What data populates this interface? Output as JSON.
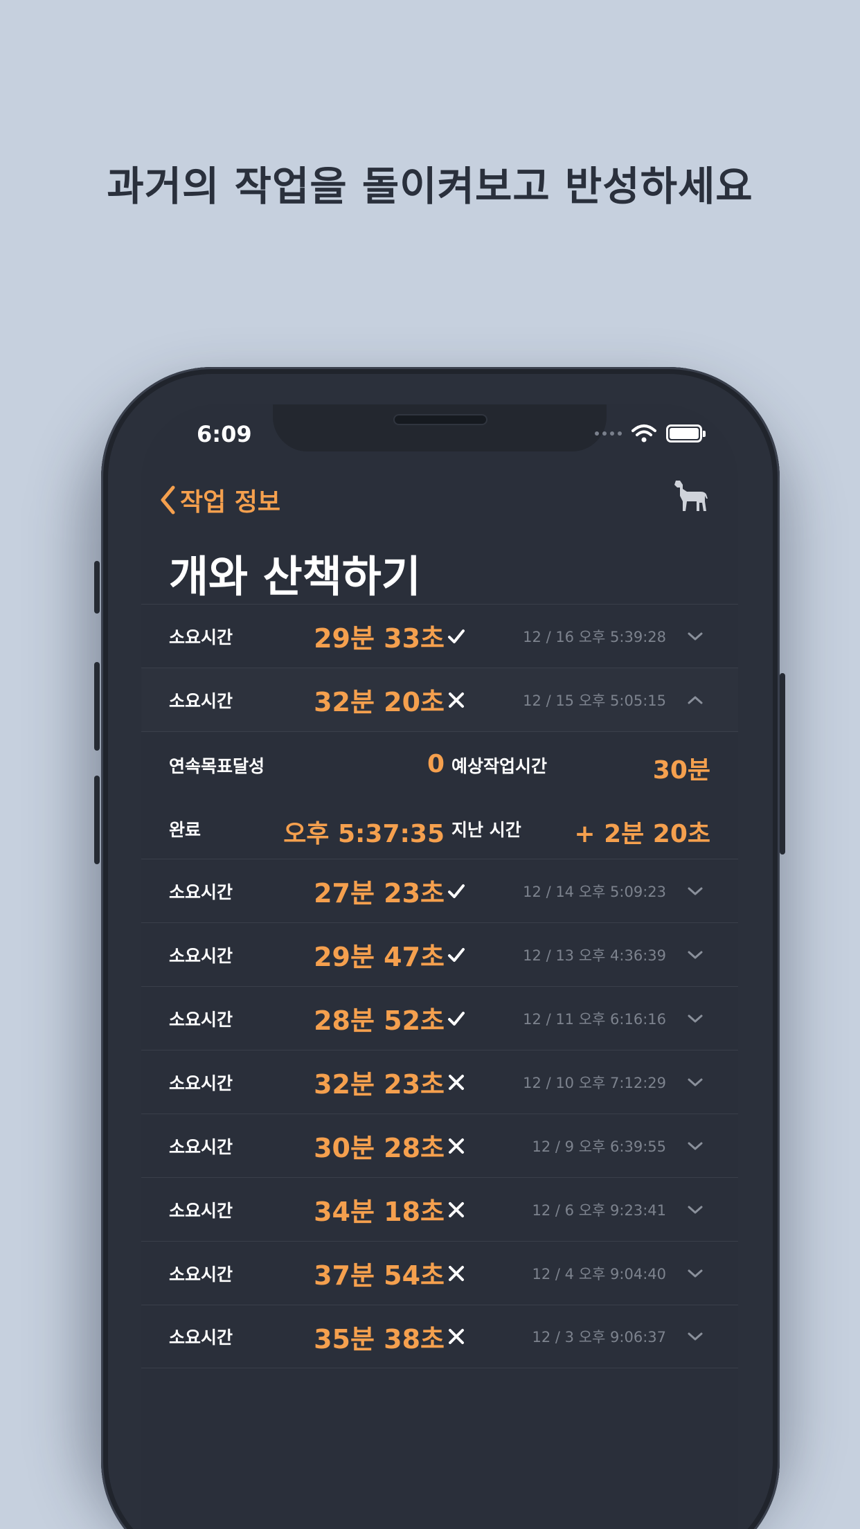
{
  "headline": "과거의 작업을 돌이켜보고 반성하세요",
  "status": {
    "time": "6:09"
  },
  "nav": {
    "back_label": "작업 정보"
  },
  "title": "개와 산책하기",
  "colors": {
    "accent": "#f5a04e",
    "background": "#2a2f3a"
  },
  "rows": [
    {
      "label": "소요시간",
      "duration": "29분 33초",
      "status": "check",
      "timestamp": "12 / 16 오후 5:39:28",
      "expanded": false
    },
    {
      "label": "소요시간",
      "duration": "32분 20초",
      "status": "x",
      "timestamp": "12 / 15 오후 5:05:15",
      "expanded": true
    },
    {
      "label": "소요시간",
      "duration": "27분 23초",
      "status": "check",
      "timestamp": "12 / 14 오후 5:09:23",
      "expanded": false
    },
    {
      "label": "소요시간",
      "duration": "29분 47초",
      "status": "check",
      "timestamp": "12 / 13 오후 4:36:39",
      "expanded": false
    },
    {
      "label": "소요시간",
      "duration": "28분 52초",
      "status": "check",
      "timestamp": "12 / 11 오후 6:16:16",
      "expanded": false
    },
    {
      "label": "소요시간",
      "duration": "32분 23초",
      "status": "x",
      "timestamp": "12 / 10 오후 7:12:29",
      "expanded": false
    },
    {
      "label": "소요시간",
      "duration": "30분 28초",
      "status": "x",
      "timestamp": "12 / 9 오후 6:39:55",
      "expanded": false
    },
    {
      "label": "소요시간",
      "duration": "34분 18초",
      "status": "x",
      "timestamp": "12 / 6 오후 9:23:41",
      "expanded": false
    },
    {
      "label": "소요시간",
      "duration": "37분 54초",
      "status": "x",
      "timestamp": "12 / 4 오후 9:04:40",
      "expanded": false
    },
    {
      "label": "소요시간",
      "duration": "35분 38초",
      "status": "x",
      "timestamp": "12 / 3 오후 9:06:37",
      "expanded": false
    }
  ],
  "detail": {
    "streak_label": "연속목표달성",
    "streak_value": "0",
    "expected_label": "예상작업시간",
    "expected_value": "30분",
    "completed_label": "완료",
    "completed_value": "오후 5:37:35",
    "elapsed_label": "지난 시간",
    "elapsed_value": "+ 2분 20초"
  }
}
